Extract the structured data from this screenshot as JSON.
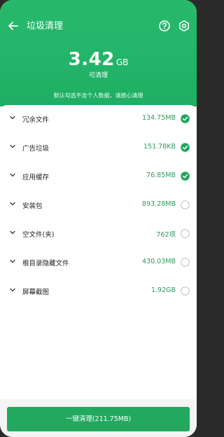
{
  "header": {
    "title": "垃圾清理",
    "size_value": "3.42",
    "size_unit": "GB",
    "size_caption": "可清理",
    "notice": "默认勾选不含个人数据，请放心清理"
  },
  "items": [
    {
      "label": "冗余文件",
      "value": "134.75MB",
      "checked": true
    },
    {
      "label": "广告垃圾",
      "value": "151.78KB",
      "checked": true
    },
    {
      "label": "应用缓存",
      "value": "76.85MB",
      "checked": true
    },
    {
      "label": "安装包",
      "value": "893.28MB",
      "checked": false
    },
    {
      "label": "空文件(夹)",
      "value": "762项",
      "checked": false
    },
    {
      "label": "根目录隐藏文件",
      "value": "430.03MB",
      "checked": false
    },
    {
      "label": "屏幕截图",
      "value": "1.92GB",
      "checked": false
    }
  ],
  "footer": {
    "button_label": "一键清理(211.75MB)"
  },
  "colors": {
    "accent": "#22b469",
    "value_text": "#2e9a5e",
    "button": "#22a95f"
  }
}
